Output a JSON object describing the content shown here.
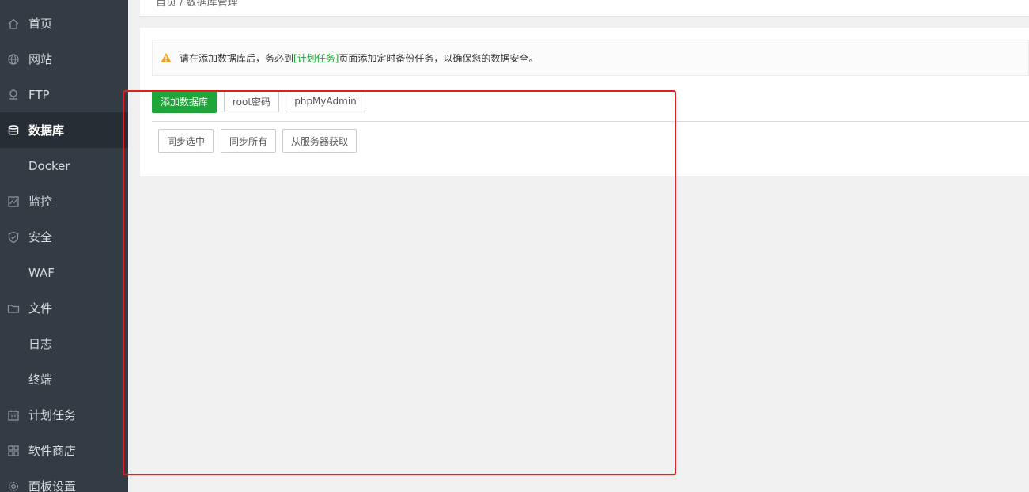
{
  "sidebar": {
    "items": [
      {
        "label": "首页",
        "icon": "home-icon"
      },
      {
        "label": "网站",
        "icon": "globe-icon"
      },
      {
        "label": "FTP",
        "icon": "ftp-icon"
      },
      {
        "label": "数据库",
        "icon": "database-icon",
        "active": true
      },
      {
        "label": "Docker",
        "icon": ""
      },
      {
        "label": "监控",
        "icon": "monitor-icon"
      },
      {
        "label": "安全",
        "icon": "shield-icon"
      },
      {
        "label": "WAF",
        "icon": ""
      },
      {
        "label": "文件",
        "icon": "folder-icon"
      },
      {
        "label": "日志",
        "icon": ""
      },
      {
        "label": "终端",
        "icon": ""
      },
      {
        "label": "计划任务",
        "icon": "calendar-icon"
      },
      {
        "label": "软件商店",
        "icon": "grid-icon"
      },
      {
        "label": "面板设置",
        "icon": "gear-icon"
      }
    ]
  },
  "breadcrumb": "首页 / 数据库管理",
  "notice": {
    "before": "请在添加数据库后，务必到",
    "link": "[计划任务]",
    "after": "页面添加定时备份任务，以确保您的数据安全。"
  },
  "toolbar": {
    "add_database": "添加数据库",
    "root_password": "root密码",
    "phpmyadmin": "phpMyAdmin"
  },
  "sync": {
    "sync_selected": "同步选中",
    "sync_all": "同步所有",
    "fetch_from_server": "从服务器获取"
  },
  "colors": {
    "sidebar_bg": "#333c45",
    "active_bg": "#272d34",
    "accent": "#20a53a",
    "warning": "#f0a020",
    "highlight_border": "#e02020"
  }
}
